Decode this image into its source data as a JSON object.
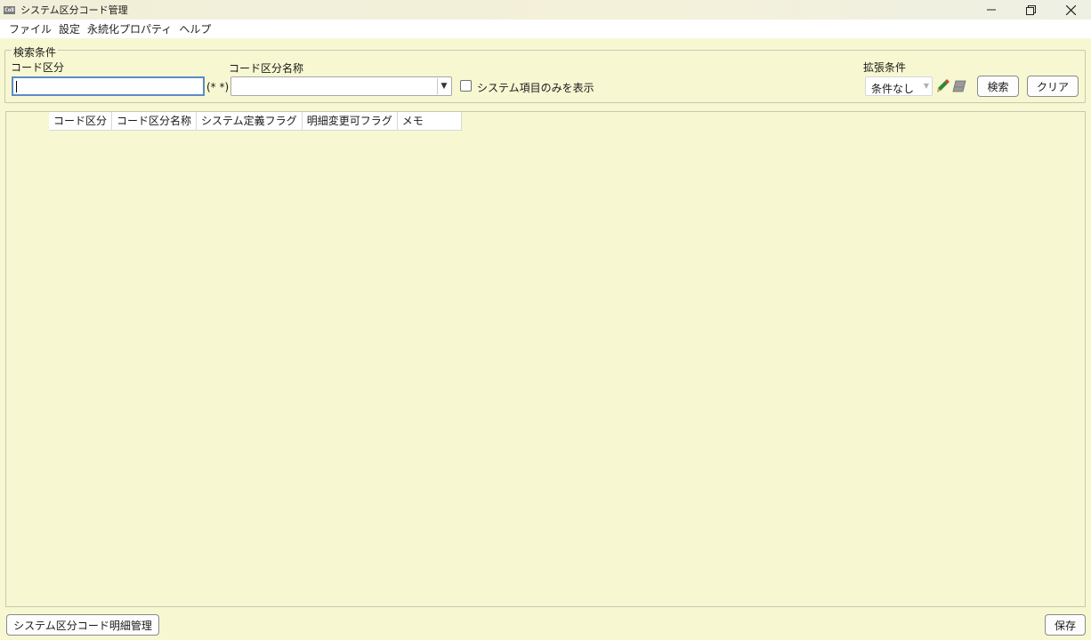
{
  "window": {
    "icon_text": "Co8",
    "title": "システム区分コード管理"
  },
  "menubar": {
    "items": [
      "ファイル",
      "設定",
      "永続化プロパティ",
      "ヘルプ"
    ]
  },
  "search": {
    "group_title": "検索条件",
    "code_label": "コード区分",
    "code_value": "",
    "code_hint": "(* *)",
    "name_label": "コード区分名称",
    "name_value": "",
    "system_only_label": "システム項目のみを表示",
    "system_only_checked": false,
    "extended_label": "拡張条件",
    "extended_value": "条件なし",
    "search_button": "検索",
    "clear_button": "クリア"
  },
  "grid": {
    "columns": [
      "コード区分",
      "コード区分名称",
      "システム定義フラグ",
      "明細変更可フラグ",
      "メモ"
    ],
    "rows": []
  },
  "footer": {
    "detail_button": "システム区分コード明細管理",
    "save_button": "保存"
  },
  "colors": {
    "background": "#f7f7d2",
    "focus_border": "#5c8bc7"
  }
}
